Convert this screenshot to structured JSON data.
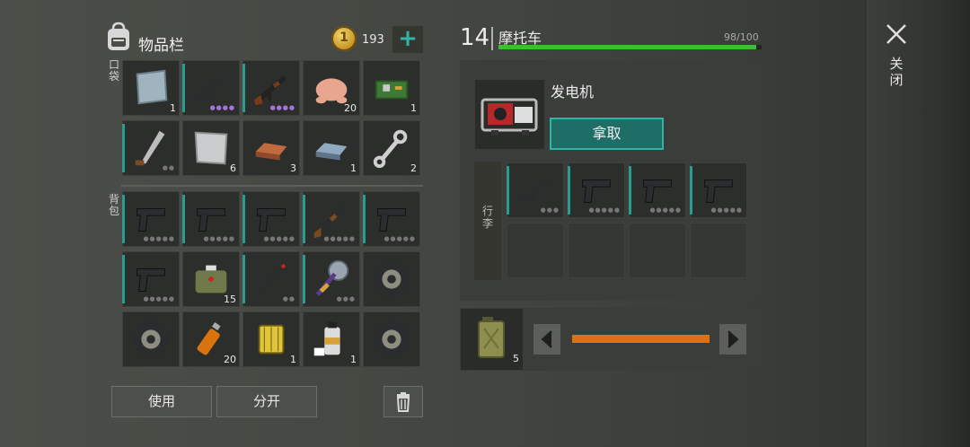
{
  "inventory": {
    "title": "物品栏",
    "coins": "193",
    "coin_symbol": "1",
    "add_label": "+",
    "pockets_label": "口袋",
    "backpack_label": "背包",
    "pockets": [
      {
        "icon": "steel-plate-icon",
        "count": "1"
      },
      {
        "icon": "assault-rifle-icon",
        "dots": "●●●●",
        "purple": true
      },
      {
        "icon": "ak-rifle-icon",
        "dots": "●●●●",
        "purple": true
      },
      {
        "icon": "raw-chicken-icon",
        "count": "20"
      },
      {
        "icon": "circuit-board-icon",
        "count": "1"
      },
      {
        "icon": "machete-icon",
        "dots": "●●"
      },
      {
        "icon": "aluminum-plate-icon",
        "count": "6"
      },
      {
        "icon": "copper-ingot-icon",
        "count": "3"
      },
      {
        "icon": "steel-ingot-icon",
        "count": "1"
      },
      {
        "icon": "wrench-icon",
        "count": "2"
      }
    ],
    "backpack": [
      {
        "icon": "pistol-icon",
        "dots": "●●●●●"
      },
      {
        "icon": "pistol-icon",
        "dots": "●●●●●"
      },
      {
        "icon": "pistol-icon",
        "dots": "●●●●●"
      },
      {
        "icon": "shotgun-icon",
        "dots": "●●●●●"
      },
      {
        "icon": "pistol-icon",
        "dots": "●●●●●"
      },
      {
        "icon": "pistol-icon",
        "dots": "●●●●●"
      },
      {
        "icon": "medkit-bag-icon",
        "count": "15"
      },
      {
        "icon": "crowbar-icon",
        "dots": "●●"
      },
      {
        "icon": "saw-blade-icon",
        "dots": "●●●"
      },
      {
        "icon": "tire-icon"
      },
      {
        "icon": "tire-icon"
      },
      {
        "icon": "lighter-icon",
        "count": "20"
      },
      {
        "icon": "air-filter-icon",
        "count": "1"
      },
      {
        "icon": "spray-paint-icon",
        "count": "1"
      },
      {
        "icon": "tire-icon"
      }
    ],
    "use_label": "使用",
    "split_label": "分开"
  },
  "vehicle": {
    "level": "14",
    "name": "摩托车",
    "durability_text": "98/100",
    "durability": 0.98,
    "durability_color": "#3dbd32",
    "part_name": "发电机",
    "take_label": "拿取",
    "trunk_label": "行李",
    "trunk": [
      {
        "icon": "assault-rifle-icon",
        "dots": "●●●"
      },
      {
        "icon": "pistol-icon",
        "dots": "●●●●●"
      },
      {
        "icon": "pistol-icon",
        "dots": "●●●●●"
      },
      {
        "icon": "pistol-icon",
        "dots": "●●●●●"
      }
    ],
    "fuel_count": "5",
    "fuel_slider_color": "#d9730e"
  },
  "close_label": "关闭"
}
